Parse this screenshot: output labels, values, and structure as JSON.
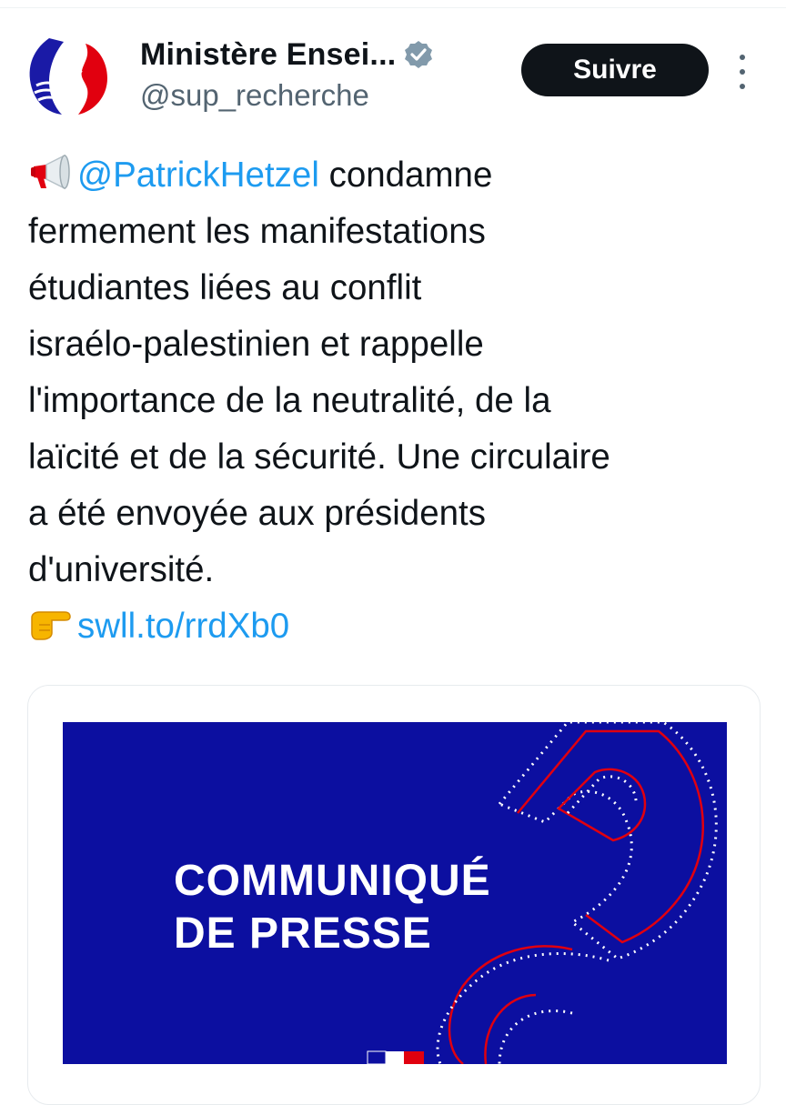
{
  "account": {
    "display_name": "Ministère Ensei...",
    "handle": "@sup_recherche",
    "verified_icon": "verified-badge-icon",
    "avatar": "ministry-logo-icon"
  },
  "actions": {
    "follow_label": "Suivre",
    "more_icon": "more-vertical-icon"
  },
  "tweet": {
    "line1_emoji": "megaphone-emoji",
    "line1_mention": "@PatrickHetzel",
    "line1_rest": " condamne",
    "line2": "fermement les manifestations",
    "line3": "étudiantes liées au conflit",
    "line4": "israélo-palestinien et rappelle",
    "line5": "l'importance de la neutralité, de la",
    "line6": "laïcité et de la sécurité. Une circulaire",
    "line7": "a été envoyée aux présidents",
    "line8": "d'université.",
    "link_emoji": "pointing-hand-emoji",
    "link": "swll.to/rrdXb0"
  },
  "card": {
    "title_line1": "COMMUNIQUÉ",
    "title_line2": "DE PRESSE",
    "background": "#0c0fa0",
    "accent_red": "#e1000f"
  }
}
